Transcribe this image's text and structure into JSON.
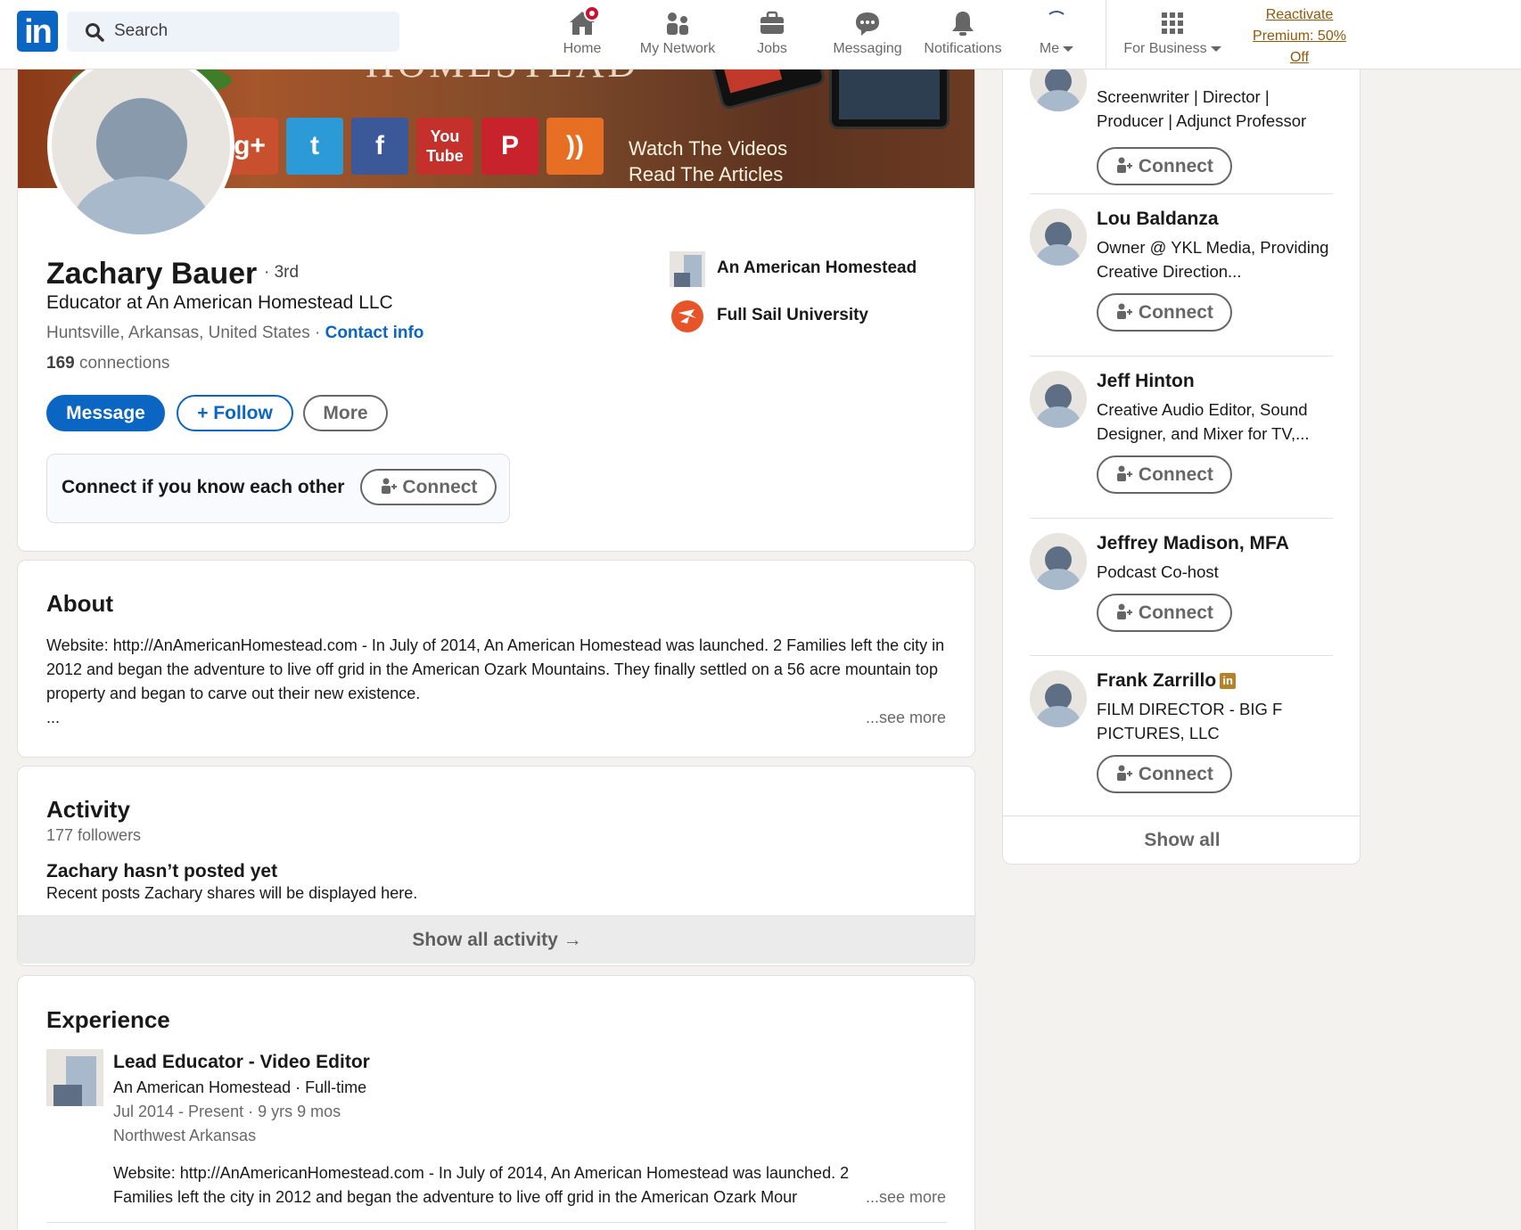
{
  "nav": {
    "logo_text": "in",
    "search_placeholder": "Search",
    "items": [
      {
        "label": "Home",
        "icon": "home-icon"
      },
      {
        "label": "My Network",
        "icon": "network-icon"
      },
      {
        "label": "Jobs",
        "icon": "briefcase-icon"
      },
      {
        "label": "Messaging",
        "icon": "messaging-icon"
      },
      {
        "label": "Notifications",
        "icon": "bell-icon"
      },
      {
        "label": "Me",
        "icon": "me-avatar"
      },
      {
        "label": "For Business",
        "icon": "grid-icon"
      }
    ],
    "premium": "Reactivate Premium: 50% Off"
  },
  "banner": {
    "title": "HOMESTEAD",
    "line1": "Watch The Videos",
    "line2": "Read The Articles"
  },
  "profile": {
    "name": "Zachary Bauer",
    "degree": "· 3rd",
    "headline": "Educator at An American Homestead LLC",
    "location": "Huntsville, Arkansas, United States ·",
    "contact_info": "Contact info",
    "connections_count": "169",
    "connections_label": "connections",
    "message_btn": "Message",
    "follow_btn": "Follow",
    "more_btn": "More",
    "connect_prompt": "Connect if you know each other",
    "connect_btn": "Connect",
    "orgs": [
      {
        "name": "An American Homestead"
      },
      {
        "name": "Full Sail University"
      }
    ]
  },
  "about": {
    "title": "About",
    "text": "Website: http://AnAmericanHomestead.com - In July of 2014, An American Homestead was launched. 2 Families left the city in 2012 and began the adventure to live off grid in the American Ozark Mountains. They finally settled on a 56 acre mountain top property and began to carve out their new existence.",
    "ellipsis": "...",
    "see_more": "...see more"
  },
  "activity": {
    "title": "Activity",
    "followers": "177 followers",
    "empty_title": "Zachary hasn’t posted yet",
    "empty_text": "Recent posts Zachary shares will be displayed here.",
    "show_all": "Show all activity →"
  },
  "experience": {
    "title": "Experience",
    "items": [
      {
        "role": "Lead Educator - Video Editor",
        "company": "An American Homestead · Full-time",
        "dates": "Jul 2014 - Present · 9 yrs 9 mos",
        "location": "Northwest Arkansas",
        "desc": "Website: http://AnAmericanHomestead.com - In July of 2014, An American Homestead was launched. 2 Families left the city in 2012 and began the adventure to live off grid in the American Ozark Mour",
        "see_more": "...see more"
      }
    ]
  },
  "sidebar": {
    "people": [
      {
        "name": "",
        "headline": "Screenwriter | Director | Producer | Adjunct Professor",
        "connect": "Connect"
      },
      {
        "name": "Lou Baldanza",
        "headline": "Owner @ YKL Media, Providing Creative Direction...",
        "connect": "Connect"
      },
      {
        "name": "Jeff Hinton",
        "headline": "Creative Audio Editor, Sound Designer, and Mixer for TV,...",
        "connect": "Connect"
      },
      {
        "name": "Jeffrey Madison, MFA",
        "headline": "Podcast Co-host",
        "connect": "Connect"
      },
      {
        "name": "Frank Zarrillo",
        "headline": "FILM DIRECTOR - BIG F PICTURES, LLC",
        "connect": "Connect",
        "badge": "in"
      }
    ],
    "show_all": "Show all"
  },
  "colors": {
    "brand": "#0a66c2",
    "premium": "#915907",
    "notification": "#cb112d"
  }
}
